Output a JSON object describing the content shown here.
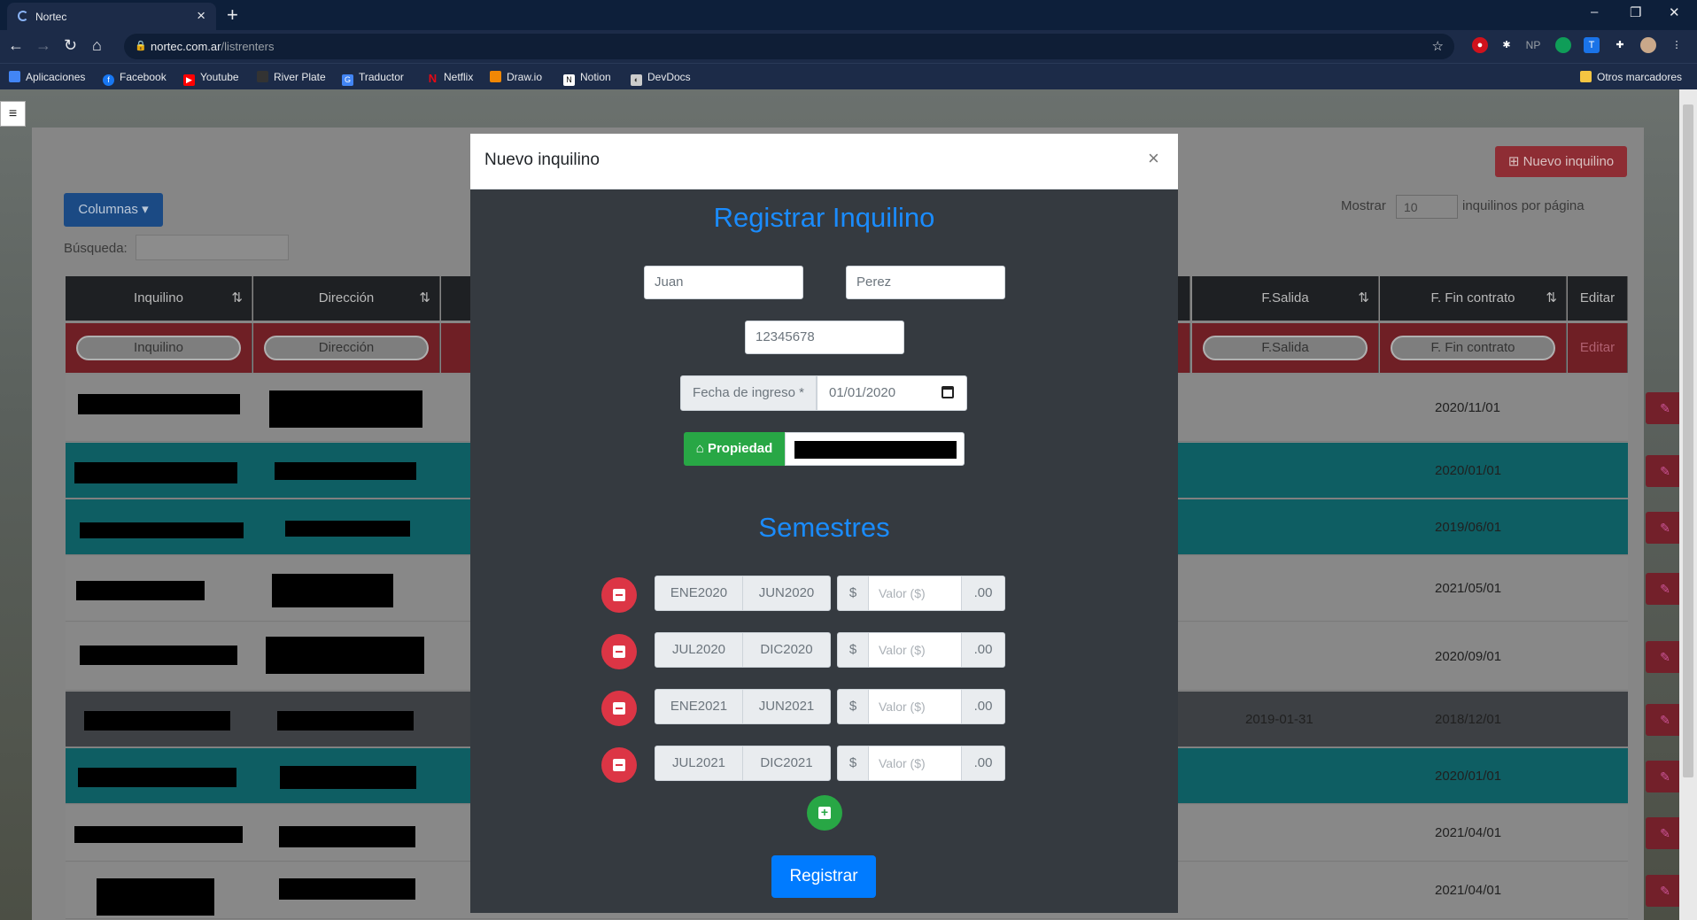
{
  "browser": {
    "tab_title": "Nortec",
    "url_host": "nortec.com.ar",
    "url_path": "/listrenters",
    "bookmarks": [
      "Aplicaciones",
      "Facebook",
      "Youtube",
      "River Plate",
      "Traductor",
      "Netflix",
      "Draw.io",
      "Notion",
      "DevDocs"
    ],
    "other_bookmarks": "Otros marcadores",
    "ext_np": "NP"
  },
  "page": {
    "new_button": "Nuevo inquilino",
    "columns_button": "Columnas",
    "show_label": "Mostrar",
    "page_size": "10",
    "per_page_label": "inquilinos por página",
    "search_label": "Búsqueda:",
    "headers": [
      "Inquilino",
      "Dirección",
      "F.Salida",
      "F. Fin contrato",
      "Editar"
    ],
    "filters": [
      "Inquilino",
      "Dirección",
      "F.Salida",
      "F. Fin contrato",
      "Editar"
    ],
    "rows": [
      {
        "fin": "2020/11/01",
        "salida": ""
      },
      {
        "fin": "2020/01/01",
        "salida": ""
      },
      {
        "fin": "2019/06/01",
        "salida": ""
      },
      {
        "fin": "2021/05/01",
        "salida": ""
      },
      {
        "fin": "2020/09/01",
        "salida": ""
      },
      {
        "fin": "2018/12/01",
        "salida": "2019-01-31"
      },
      {
        "fin": "2020/01/01",
        "salida": ""
      },
      {
        "fin": "2021/04/01",
        "salida": ""
      },
      {
        "fin": "2021/04/01",
        "salida": ""
      }
    ],
    "row_colors": [
      "#888888",
      "#0e5e63",
      "#0e5e63",
      "#888888",
      "#888888",
      "#3d4044",
      "#0e5e63",
      "#888888",
      "#888888"
    ]
  },
  "modal": {
    "title": "Nuevo inquilino",
    "close": "×",
    "heading": "Registrar Inquilino",
    "first_name": "Juan",
    "last_name": "Perez",
    "dni": "12345678",
    "date_label": "Fecha de ingreso *",
    "date_value": "01/01/2020",
    "property_button": "Propiedad",
    "semesters_heading": "Semestres",
    "semesters": [
      {
        "start": "ENE2020",
        "end": "JUN2020"
      },
      {
        "start": "JUL2020",
        "end": "DIC2020"
      },
      {
        "start": "ENE2021",
        "end": "JUN2021"
      },
      {
        "start": "JUL2021",
        "end": "DIC2021"
      }
    ],
    "currency": "$",
    "value_placeholder": "Valor ($)",
    "cents": ".00",
    "submit": "Registrar"
  }
}
